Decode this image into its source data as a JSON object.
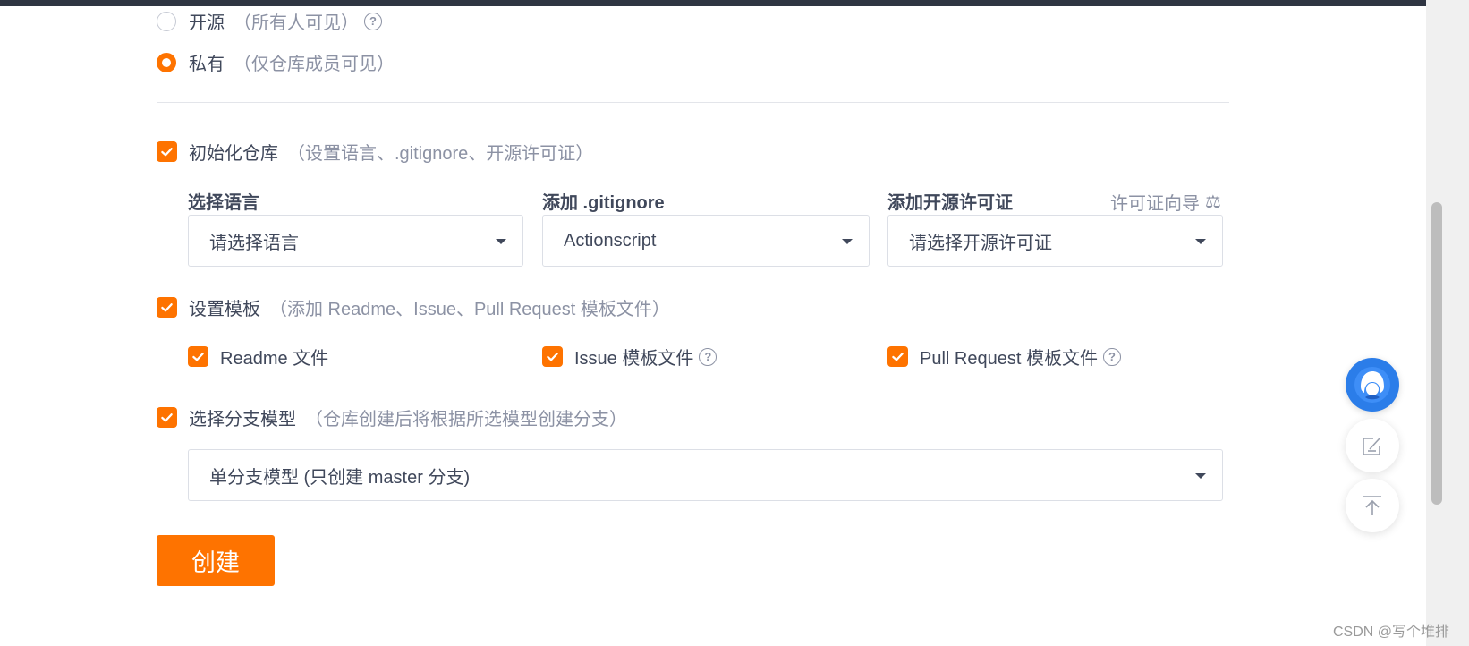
{
  "visibility": {
    "options": [
      {
        "label": "开源",
        "hint": "（所有人可见）",
        "checked": false,
        "has_help": true
      },
      {
        "label": "私有",
        "hint": "（仅仓库成员可见）",
        "checked": true,
        "has_help": false
      }
    ]
  },
  "init_repo": {
    "label": "初始化仓库",
    "hint": "（设置语言、.gitignore、开源许可证）",
    "checked": true,
    "language": {
      "title": "选择语言",
      "value": "请选择语言"
    },
    "gitignore": {
      "title": "添加 .gitignore",
      "value": "Actionscript"
    },
    "license": {
      "title": "添加开源许可证",
      "value": "请选择开源许可证",
      "wizard_link": "许可证向导",
      "wizard_icon": "scale-icon"
    }
  },
  "template": {
    "label": "设置模板",
    "hint": "（添加 Readme、Issue、Pull Request 模板文件）",
    "checked": true,
    "items": [
      {
        "label": "Readme 文件",
        "checked": true,
        "has_help": false
      },
      {
        "label": "Issue 模板文件",
        "checked": true,
        "has_help": true
      },
      {
        "label": "Pull Request 模板文件",
        "checked": true,
        "has_help": true
      }
    ]
  },
  "branch_model": {
    "label": "选择分支模型",
    "hint": "（仓库创建后将根据所选模型创建分支）",
    "checked": true,
    "value": "单分支模型 (只创建 master 分支)"
  },
  "create_button": "创建",
  "floating": {
    "avatar_icon": "assistant-avatar-icon",
    "feedback_icon": "feedback-edit-icon",
    "top_icon": "back-to-top-icon"
  },
  "watermark": "CSDN @写个堆排",
  "colors": {
    "accent": "#fe7300",
    "text": "#40485b",
    "hint": "#8c92a4"
  }
}
